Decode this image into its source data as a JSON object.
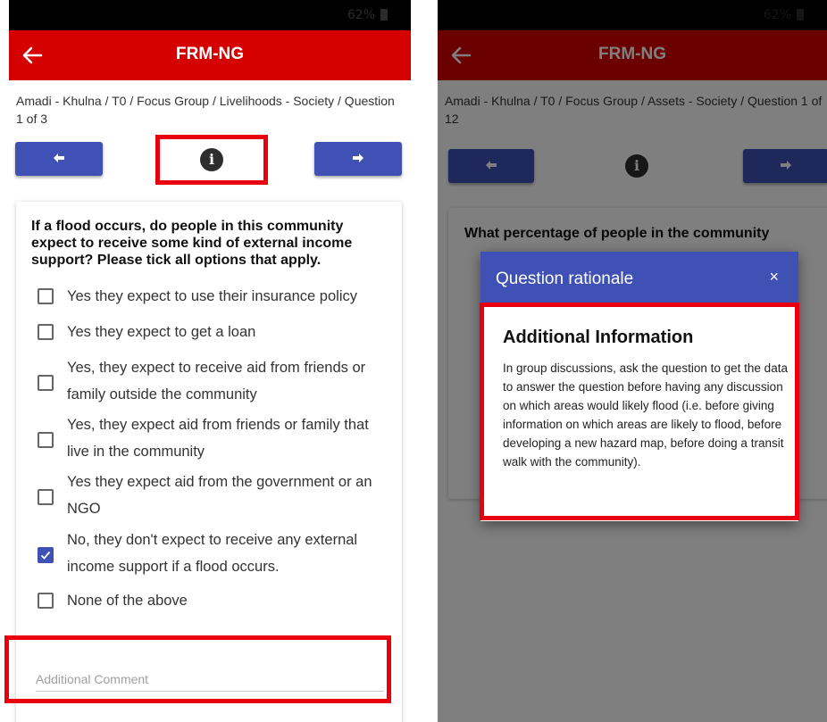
{
  "left": {
    "status": "62%",
    "app_title": "FRM-NG",
    "breadcrumb": "Amadi - Khulna / T0 / Focus Group / Livelihoods - Society / Question 1 of 3",
    "prev_icon": "arrow-left-icon",
    "next_icon": "arrow-right-icon",
    "info_glyph": "i",
    "question": "If a flood occurs, do people in this community expect to receive some kind of external income support? Please tick all options that apply.",
    "options": [
      {
        "label": "Yes they expect to use their insurance policy",
        "checked": false
      },
      {
        "label": "Yes they expect to get a loan",
        "checked": false
      },
      {
        "label": "Yes, they expect to receive aid from friends or family outside the community",
        "checked": false
      },
      {
        "label": "Yes, they expect aid from friends or family that live in the community",
        "checked": false
      },
      {
        "label": "Yes they expect aid from the government or an NGO",
        "checked": false
      },
      {
        "label": "No, they don't expect to receive any external income support if a flood occurs.",
        "checked": true
      },
      {
        "label": "None of the above",
        "checked": false
      }
    ],
    "comment_placeholder": "Additional Comment"
  },
  "right": {
    "status": "62%",
    "app_title": "FRM-NG",
    "breadcrumb": "Amadi - Khulna / T0 / Focus Group / Assets - Society / Question 1 of 12",
    "info_glyph": "i",
    "question_visible": "What percentage of people in the community",
    "dialog": {
      "title": "Question rationale",
      "close": "×",
      "heading": "Additional Information",
      "body": "In group discussions, ask the question to get the data to answer the question before having any discussion on which areas would likely flood (i.e. before giving information on which areas are likely to flood, before developing a new hazard map, before doing a transit walk with the community)."
    }
  },
  "colors": {
    "app_bar": "#d50000",
    "primary": "#3f51b5",
    "highlight": "#e8000f"
  }
}
